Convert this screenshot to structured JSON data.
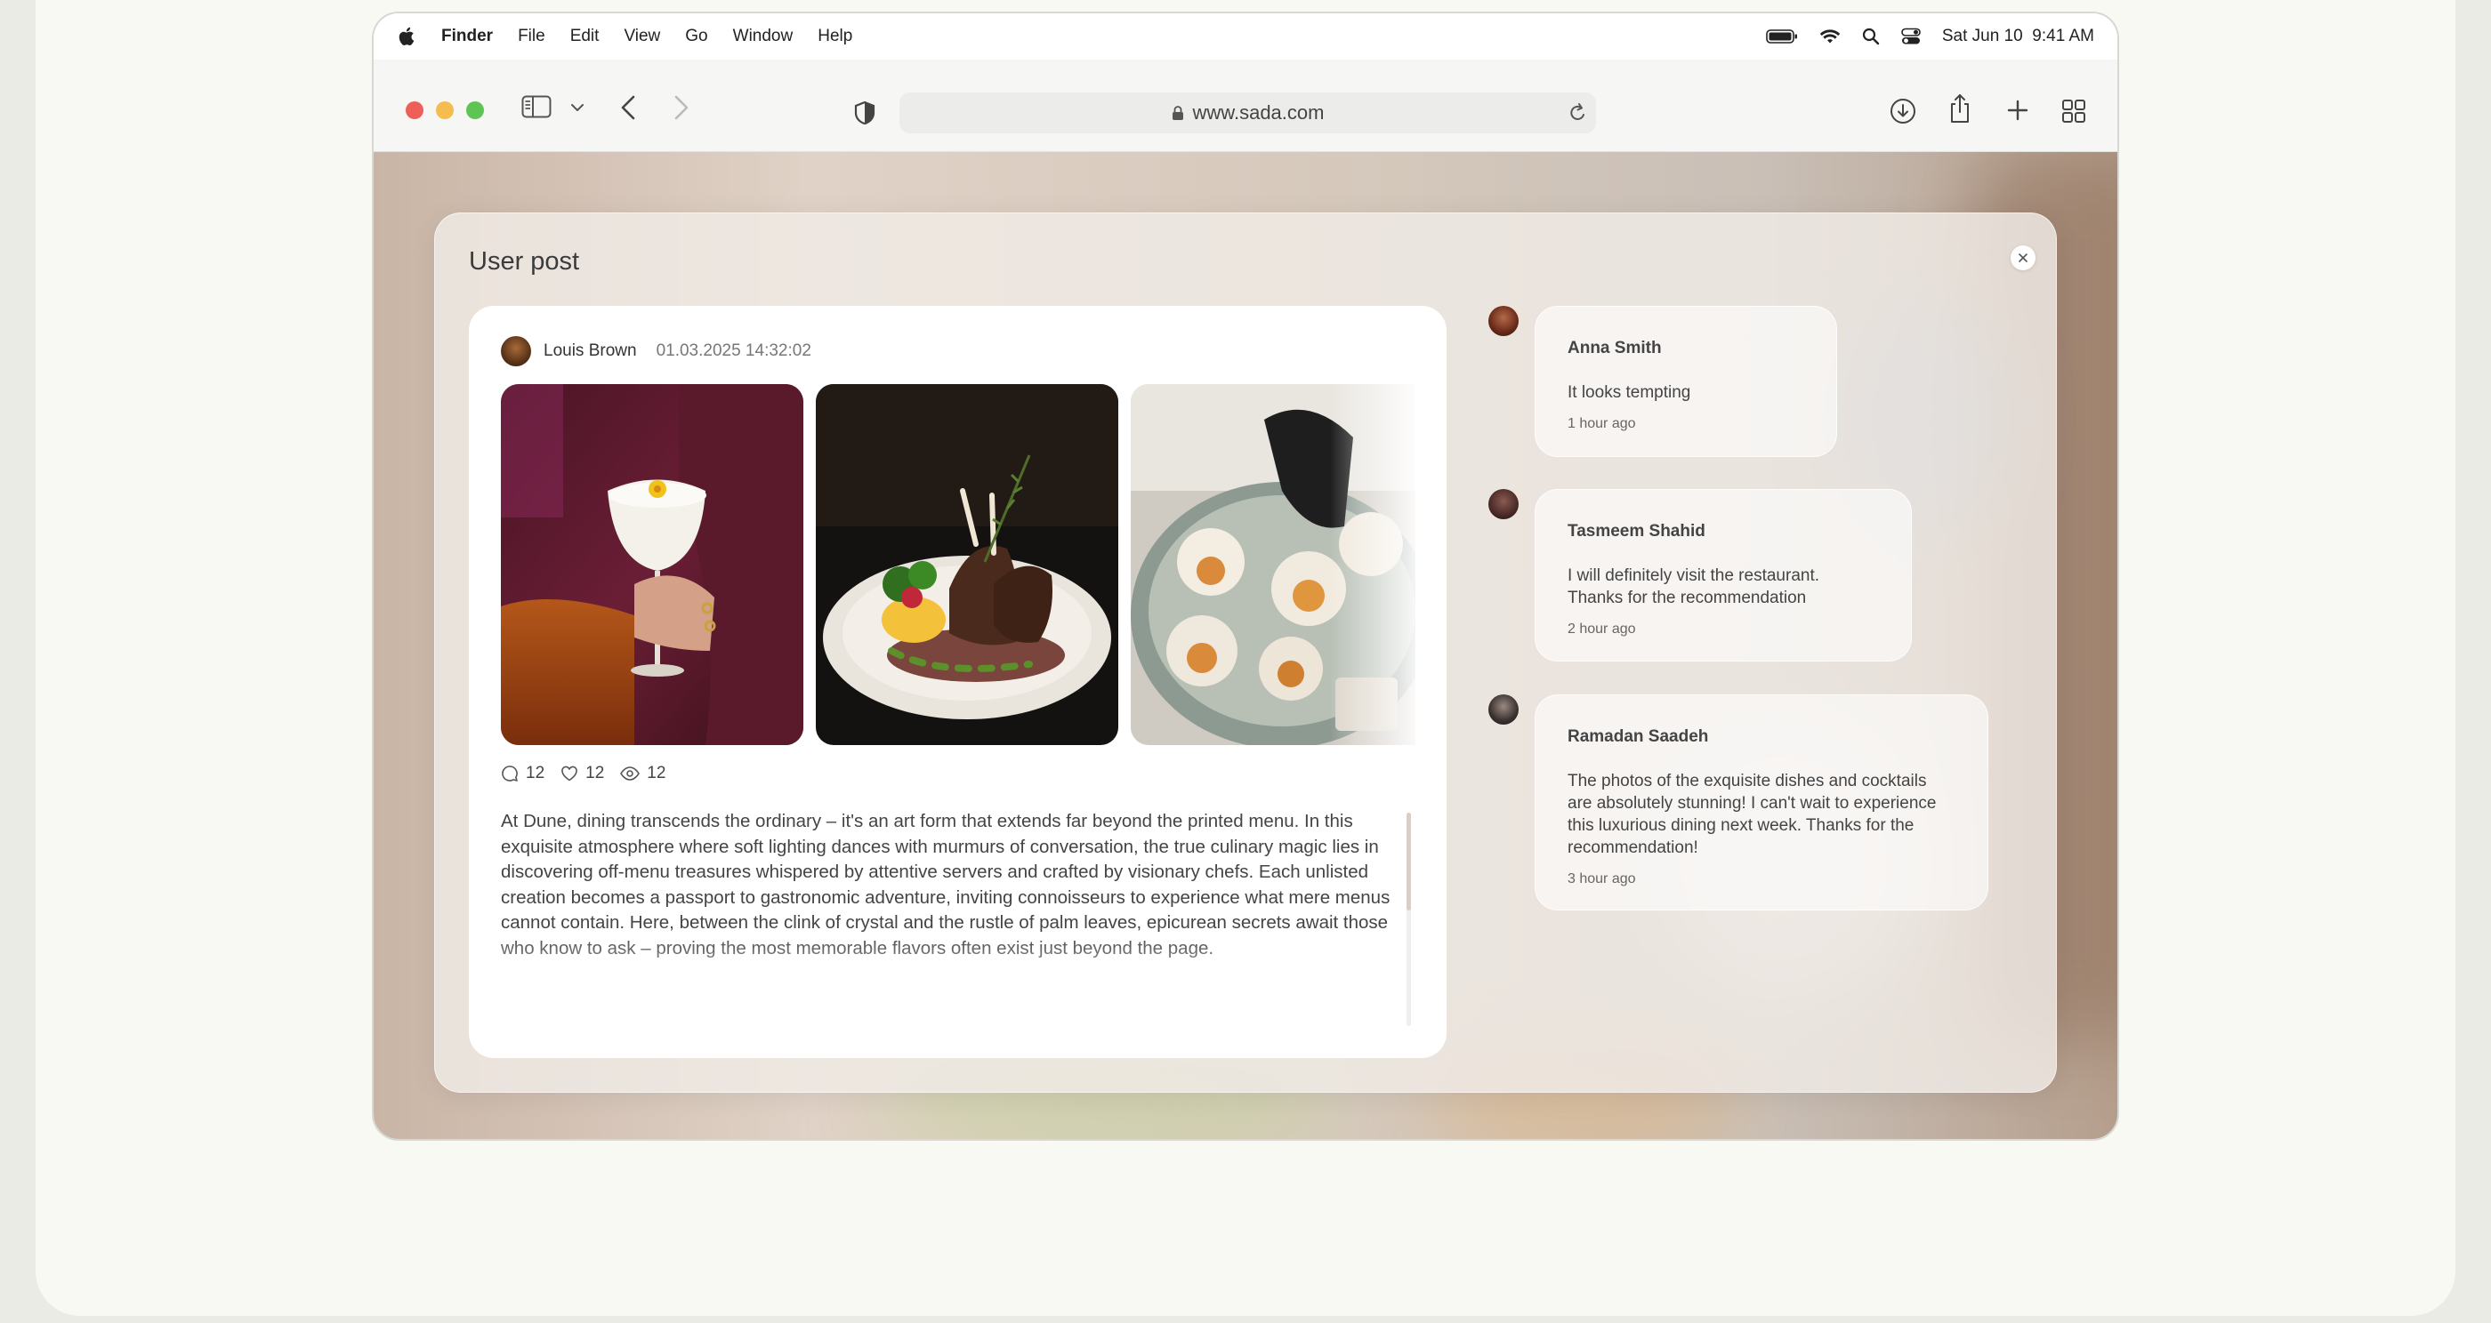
{
  "menubar": {
    "app": "Finder",
    "items": [
      "File",
      "Edit",
      "View",
      "Go",
      "Window",
      "Help"
    ],
    "datetime": "Sat Jun 10  9:41 AM"
  },
  "browser": {
    "url": "www.sada.com"
  },
  "modal": {
    "title": "User post"
  },
  "post": {
    "author": "Louis Brown",
    "date": "01.03.2025 14:32:02",
    "comments_count": "12",
    "likes_count": "12",
    "views_count": "12",
    "text": "At Dune, dining transcends the ordinary – it's an art form that extends far beyond the printed menu. In this exquisite atmosphere where soft lighting dances with murmurs of conversation, the true culinary magic lies in discovering off-menu treasures whispered by attentive servers and crafted by visionary chefs. Each unlisted creation becomes a passport to gastronomic adventure, inviting connoisseurs to experience what mere menus cannot contain. Here, between the clink of crystal and the rustle of palm leaves, epicurean secrets await those who know to ask – proving the most memorable flavors often exist just beyond the page."
  },
  "comments": [
    {
      "name": "Anna Smith",
      "text": "It looks tempting",
      "time": "1 hour ago"
    },
    {
      "name": "Tasmeem Shahid",
      "text": "I will definitely visit the restaurant. Thanks for the recommendation",
      "time": "2 hour ago"
    },
    {
      "name": "Ramadan Saadeh",
      "text": "The photos of the exquisite dishes and cocktails are absolutely stunning! I can't wait to experience this luxurious dining next week. Thanks for the recommendation!",
      "time": "3 hour ago"
    }
  ],
  "colors": {
    "close": "#ee5f57",
    "minimize": "#f5bd4f",
    "zoom": "#5ec454"
  }
}
